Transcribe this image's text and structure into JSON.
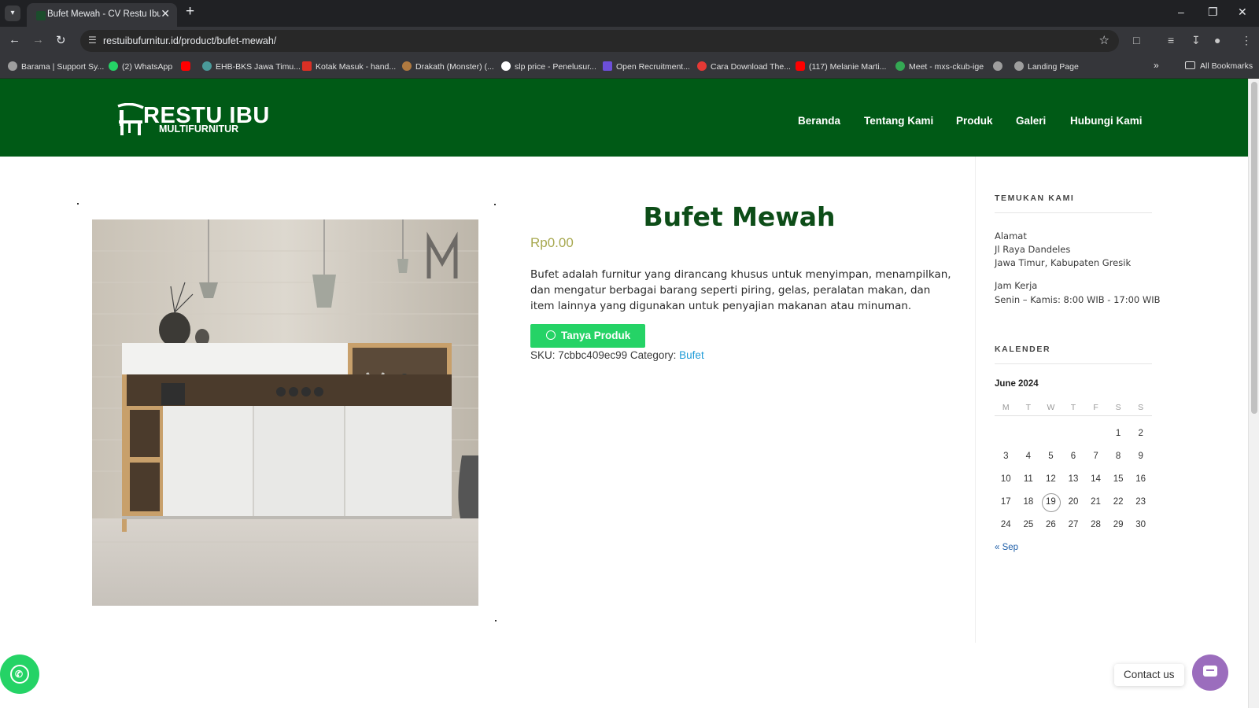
{
  "browser": {
    "tab_title": "Bufet Mewah - CV Restu Ibu Fu",
    "url": "restuibufurnitur.id/product/bufet-mewah/",
    "bookmarks": [
      "Barama | Support Sy...",
      "(2) WhatsApp",
      "",
      "EHB-BKS Jawa Timu...",
      "Kotak Masuk - hand...",
      "Drakath (Monster) (...",
      "slp price - Penelusur...",
      "Open Recruitment...",
      "Cara Download The...",
      "(117) Melanie Marti...",
      "Meet - mxs-ckub-ige",
      "",
      "Landing Page"
    ],
    "all_bookmarks": "All Bookmarks"
  },
  "site": {
    "logo_title": "RESTU IBU",
    "logo_subtitle": "MULTIFURNITUR",
    "nav": [
      "Beranda",
      "Tentang Kami",
      "Produk",
      "Galeri",
      "Hubungi Kami"
    ]
  },
  "product": {
    "title": "Bufet Mewah",
    "price": "Rp0.00",
    "description": "Bufet adalah furnitur yang dirancang khusus untuk menyimpan, menampilkan, dan mengatur berbagai barang seperti piring, gelas, peralatan makan, dan item lainnya yang digunakan untuk penyajian makanan atau minuman.",
    "ask_button": "Tanya Produk",
    "sku_label": "SKU:",
    "sku": "7cbbc409ec99",
    "category_label": "Category:",
    "category": "Bufet"
  },
  "sidebar": {
    "find_us_title": "TEMUKAN KAMI",
    "address_label": "Alamat",
    "address_line1": "Jl Raya Dandeles",
    "address_line2": "Jawa Timur, Kabupaten Gresik",
    "hours_label": "Jam Kerja",
    "hours": "Senin – Kamis: 8:00 WIB - 17:00 WIB",
    "calendar_title": "KALENDER",
    "calendar": {
      "caption": "June 2024",
      "weekdays": [
        "M",
        "T",
        "W",
        "T",
        "F",
        "S",
        "S"
      ],
      "weeks": [
        [
          "",
          "",
          "",
          "",
          "",
          "1",
          "2"
        ],
        [
          "3",
          "4",
          "5",
          "6",
          "7",
          "8",
          "9"
        ],
        [
          "10",
          "11",
          "12",
          "13",
          "14",
          "15",
          "16"
        ],
        [
          "17",
          "18",
          "19",
          "20",
          "21",
          "22",
          "23"
        ],
        [
          "24",
          "25",
          "26",
          "27",
          "28",
          "29",
          "30"
        ]
      ],
      "today": "19",
      "prev_link": "« Sep"
    }
  },
  "floating": {
    "contact_label": "Contact us"
  },
  "colors": {
    "header_green": "#005a16",
    "title_green": "#0d4d18",
    "price_gold": "#a7a84f",
    "whatsapp": "#25d366",
    "contact_purple": "#9b6dbd",
    "link_blue": "#1e9bd7"
  }
}
